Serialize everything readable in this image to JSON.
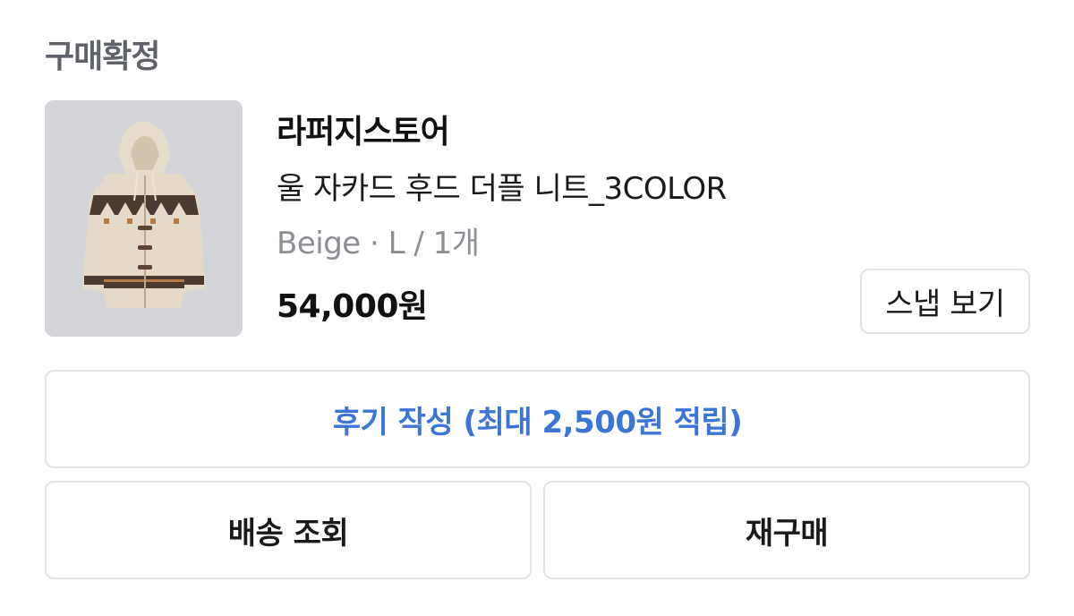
{
  "order": {
    "status_label": "구매확정",
    "store_name": "라퍼지스토어",
    "product_name": "울 자카드 후드 더플 니트_3COLOR",
    "option_text": "Beige · L / 1개",
    "price": "54,000원",
    "image_icon": "hooded-knit-cardigan-photo"
  },
  "actions": {
    "snap_label": "스냅 보기",
    "review_label": "후기 작성 (최대 2,500원 적립)",
    "shipping_label": "배송 조회",
    "rebuy_label": "재구매"
  },
  "colors": {
    "review_accent": "#3b75d6",
    "status_gray": "#5f6369",
    "option_gray": "#8b8f95"
  }
}
